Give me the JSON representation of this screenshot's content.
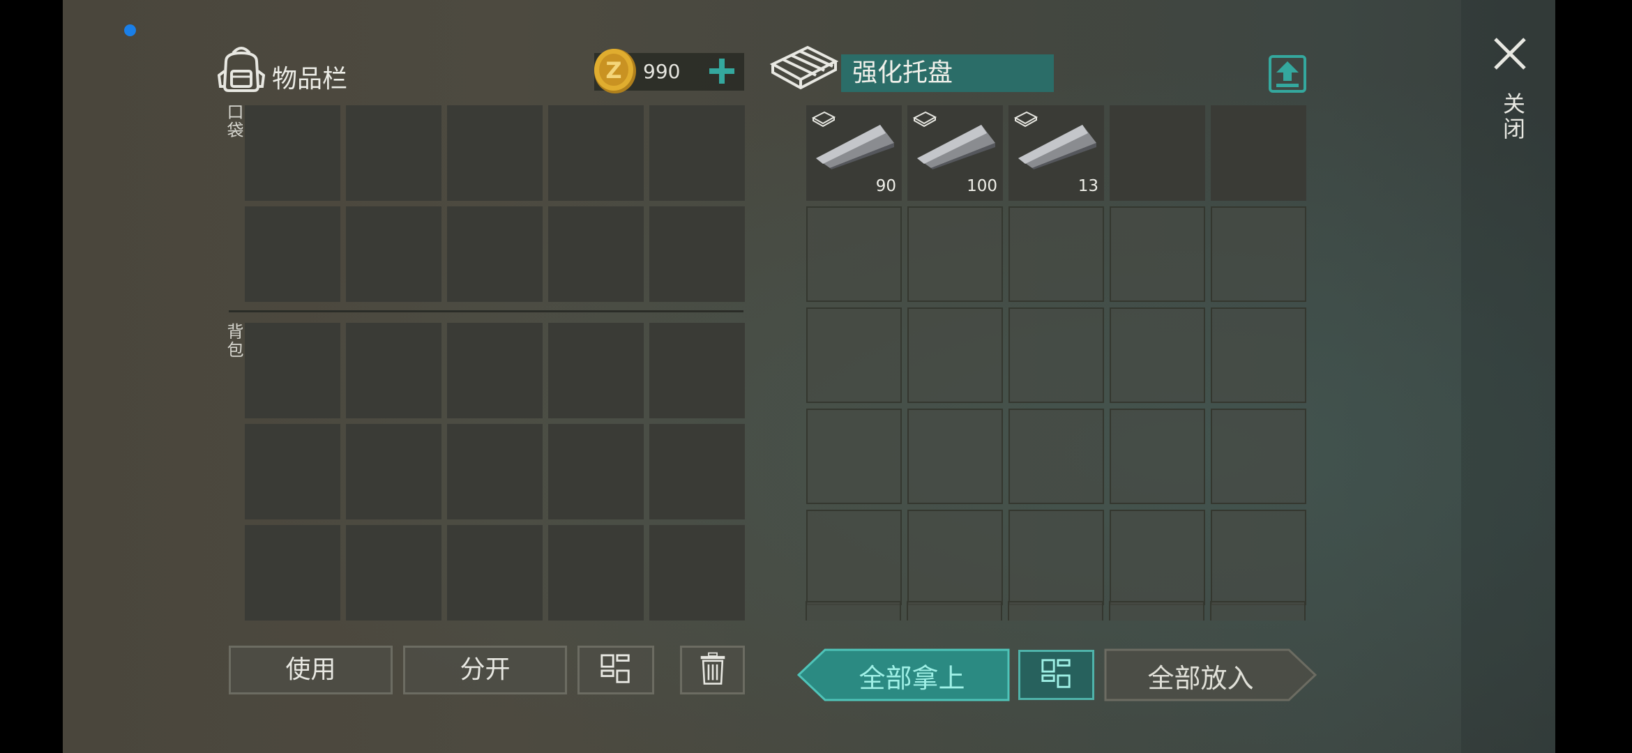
{
  "inventory": {
    "title": "物品栏",
    "coins": "990",
    "pocket_label": "口袋",
    "backpack_label": "背包"
  },
  "container": {
    "name": "强化托盘",
    "items": [
      {
        "name": "reinforcement-bar",
        "qty": "90"
      },
      {
        "name": "reinforcement-bar",
        "qty": "100"
      },
      {
        "name": "reinforcement-bar",
        "qty": "13"
      }
    ]
  },
  "close_label": "关闭",
  "buttons": {
    "use": "使用",
    "split": "分开",
    "take_all": "全部拿上",
    "put_all": "全部放入"
  },
  "colors": {
    "accent": "#2b6d68",
    "accent_bright": "#34a89e",
    "slot": "#3a3b36",
    "status_dot": "#1a7fe8"
  },
  "icons": [
    "backpack-icon",
    "coin-icon",
    "plus-icon",
    "pallet-icon",
    "upload-icon",
    "close-icon",
    "sort-icon",
    "trash-icon"
  ]
}
